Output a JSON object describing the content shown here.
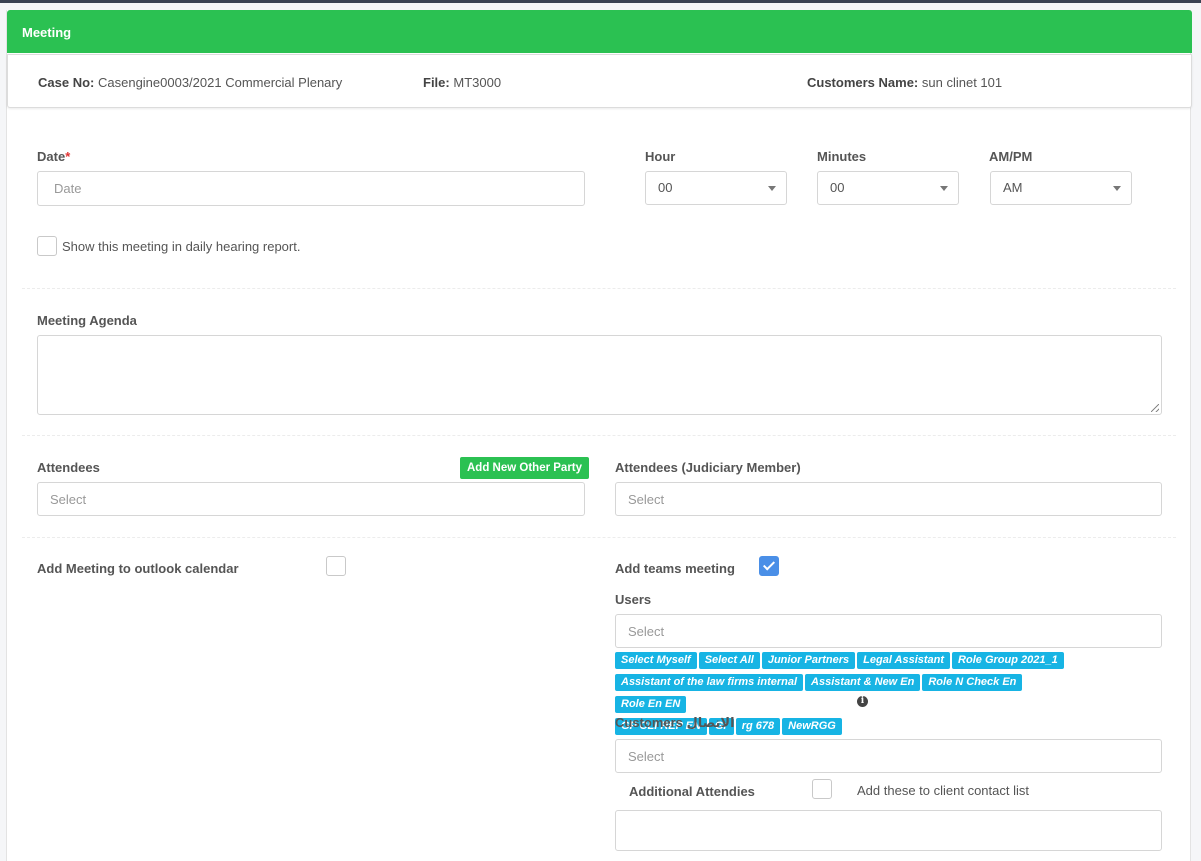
{
  "header": {
    "title": "Meeting"
  },
  "case": {
    "case_no_label": "Case No:",
    "case_no_value": "Casengine0003/2021 Commercial Plenary",
    "file_label": "File:",
    "file_value": "MT3000",
    "customer_label": "Customers Name:",
    "customer_value": "sun clinet 101"
  },
  "form": {
    "date_label": "Date",
    "date_required": "*",
    "date_placeholder": "Date",
    "hour_label": "Hour",
    "hour_value": "00",
    "minutes_label": "Minutes",
    "minutes_value": "00",
    "ampm_label": "AM/PM",
    "ampm_value": "AM",
    "daily_report_label": "Show this meeting in daily hearing report.",
    "agenda_label": "Meeting Agenda",
    "attendees_label": "Attendees",
    "add_other_party": "Add New Other Party",
    "attendees_placeholder": "Select",
    "judiciary_label": "Attendees (Judiciary Member)",
    "judiciary_placeholder": "Select",
    "outlook_label": "Add Meeting to outlook calendar",
    "teams_label": "Add teams meeting",
    "users_label": "Users",
    "users_placeholder": "Select",
    "user_tags": [
      "Select Myself",
      "Select All",
      "Junior Partners",
      "Legal Assistant",
      "Role Group 2021_1",
      "Assistant of the law firms internal",
      "Assistant & New En",
      "Role N Check En",
      "Role En EN",
      "GP CLI REP EN",
      "Gr",
      "rg 678",
      "NewRGG"
    ],
    "customers_label": "Customers الاتصال",
    "customers_placeholder": "Select",
    "additional_label": "Additional Attendies",
    "client_contact_label": "Add these to client contact list"
  },
  "colors": {
    "accent": "#2bc152",
    "tag": "#17b4e4",
    "check": "#4a8fe7"
  }
}
